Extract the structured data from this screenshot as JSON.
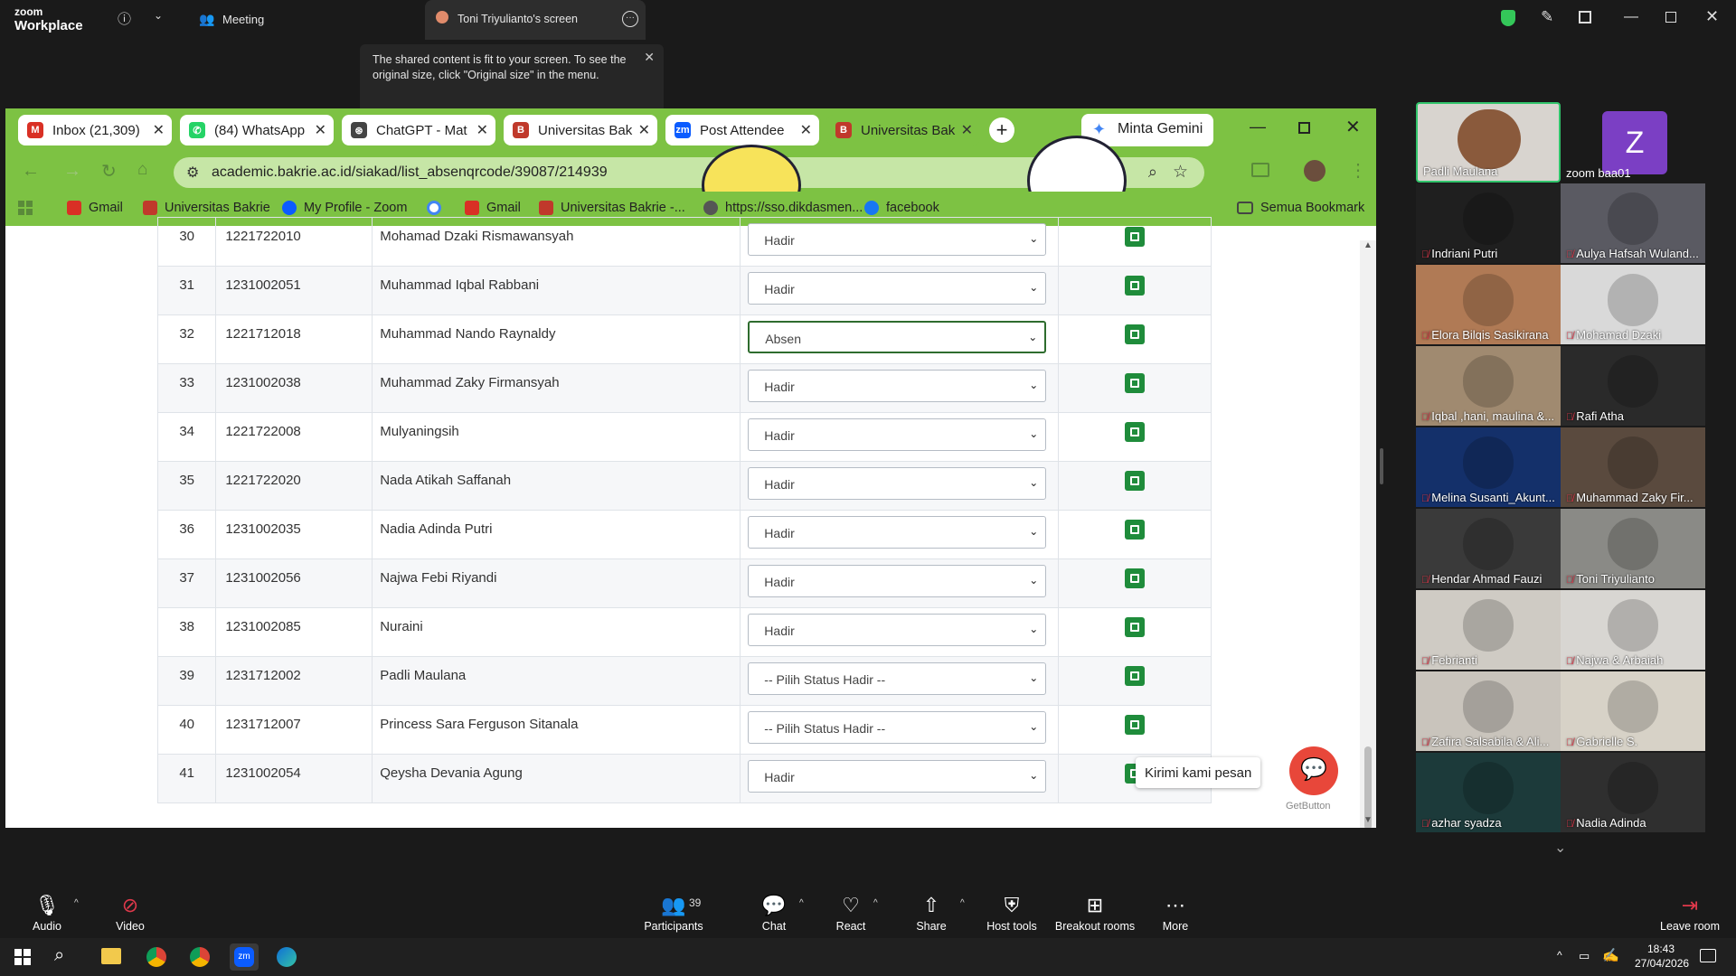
{
  "zoom": {
    "logo_line1": "zoom",
    "logo_line2": "Workplace",
    "meeting_label": "Meeting",
    "share_title": "Toni Triyulianto's screen",
    "tooltip": "The shared content is fit to your screen. To see the original size, click \"Original size\" in the menu."
  },
  "browser": {
    "tabs": [
      {
        "label": "Inbox (21,309)",
        "icon_color": "#d93025",
        "icon": "gmail-icon"
      },
      {
        "label": "(84) WhatsApp",
        "icon_color": "#25d366",
        "icon": "whatsapp-icon"
      },
      {
        "label": "ChatGPT - Mat",
        "icon_color": "#444444",
        "icon": "chatgpt-icon"
      },
      {
        "label": "Universitas Bak",
        "icon_color": "#c0392b",
        "icon": "bakrie-icon"
      },
      {
        "label": "Post Attendee",
        "icon_color": "#0b5cff",
        "icon": "zoom-icon"
      },
      {
        "label": "Universitas Bak",
        "icon_color": "#c0392b",
        "icon": "bakrie-icon"
      }
    ],
    "gemini_button": "Minta Gemini",
    "url": "academic.bakrie.ac.id/siakad/list_absenqrcode/39087/214939",
    "bookmarks": [
      {
        "label": "Gmail",
        "color": "#d93025"
      },
      {
        "label": "Universitas Bakrie",
        "color": "#c0392b"
      },
      {
        "label": "My Profile - Zoom",
        "color": "#0b5cff"
      },
      {
        "label": "",
        "color": "#4285f4"
      },
      {
        "label": "Gmail",
        "color": "#d93025"
      },
      {
        "label": "Universitas Bakrie -...",
        "color": "#c0392b"
      },
      {
        "label": "https://sso.dikdasmen...",
        "color": "#555555"
      },
      {
        "label": "facebook",
        "color": "#1877f2"
      }
    ],
    "all_bookmarks": "Semua Bookmark"
  },
  "attendance": {
    "rows": [
      {
        "no": "30",
        "nim": "1221722010",
        "name": "Mohamad Dzaki Rismawansyah",
        "status": "Hadir"
      },
      {
        "no": "31",
        "nim": "1231002051",
        "name": "Muhammad Iqbal Rabbani",
        "status": "Hadir"
      },
      {
        "no": "32",
        "nim": "1221712018",
        "name": "Muhammad Nando Raynaldy",
        "status": "Absen"
      },
      {
        "no": "33",
        "nim": "1231002038",
        "name": "Muhammad Zaky Firmansyah",
        "status": "Hadir"
      },
      {
        "no": "34",
        "nim": "1221722008",
        "name": "Mulyaningsih",
        "status": "Hadir"
      },
      {
        "no": "35",
        "nim": "1221722020",
        "name": "Nada Atikah Saffanah",
        "status": "Hadir"
      },
      {
        "no": "36",
        "nim": "1231002035",
        "name": "Nadia Adinda Putri",
        "status": "Hadir"
      },
      {
        "no": "37",
        "nim": "1231002056",
        "name": "Najwa Febi Riyandi",
        "status": "Hadir"
      },
      {
        "no": "38",
        "nim": "1231002085",
        "name": "Nuraini",
        "status": "Hadir"
      },
      {
        "no": "39",
        "nim": "1231712002",
        "name": "Padli Maulana",
        "status": "-- Pilih Status Hadir --"
      },
      {
        "no": "40",
        "nim": "1231712007",
        "name": "Princess Sara Ferguson Sitanala",
        "status": "-- Pilih Status Hadir --"
      },
      {
        "no": "41",
        "nim": "1231002054",
        "name": "Qeysha Devania Agung",
        "status": "Hadir"
      }
    ],
    "chat_prompt": "Kirimi kami pesan",
    "getbutton": "GetButton"
  },
  "gallery": {
    "top": [
      {
        "name": "Padli Maulana",
        "bg": "#d8d4cf",
        "active": true
      },
      {
        "name": "zoom baa01",
        "bg": "#1a1a1a",
        "avatar_letter": "Z",
        "avatar_color": "#7b3fc4"
      }
    ],
    "tiles": [
      {
        "name": "Indriani Putri",
        "bg": "#1f1f1f"
      },
      {
        "name": "Aulya Hafsah Wulandari",
        "display": "Aulya Hafsah Wuland...",
        "bg": "#5a5a62"
      },
      {
        "name": "Elora Bilqis Sasikirana",
        "bg": "#b07a55"
      },
      {
        "name": "Mohamad Dzaki",
        "bg": "#d9d9d9"
      },
      {
        "name": "Iqbal ,hani, maulina &...",
        "bg": "#a08a70"
      },
      {
        "name": "Rafi Atha",
        "bg": "#2a2a2a"
      },
      {
        "name": "Melina Susanti_Akunt...",
        "bg": "#14306a"
      },
      {
        "name": "Muhammad Zaky Fir...",
        "bg": "#5a4a3e"
      },
      {
        "name": "Hendar Ahmad Fauzi",
        "bg": "#3a3a3a"
      },
      {
        "name": "Toni Triyulianto",
        "bg": "#8a8a86"
      },
      {
        "name": "Febrianti",
        "bg": "#cfcbc4"
      },
      {
        "name": "Najwa & Arbaiah",
        "bg": "#d8d6d2"
      },
      {
        "name": "Zafira Salsabila & Ali...",
        "bg": "#c9c4bc"
      },
      {
        "name": "Gabrielle S.",
        "bg": "#d7d2c7"
      },
      {
        "name": "azhar syadza",
        "bg": "#1c3a3a"
      },
      {
        "name": "Nadia Adinda",
        "bg": "#2f2f2f"
      }
    ]
  },
  "toolbar": {
    "audio": "Audio",
    "video": "Video",
    "participants": "Participants",
    "participant_count": "39",
    "chat": "Chat",
    "react": "React",
    "share": "Share",
    "host_tools": "Host tools",
    "breakout": "Breakout rooms",
    "more": "More",
    "leave": "Leave room"
  },
  "taskbar": {
    "time": "18:43",
    "date": "27/04/2026"
  }
}
